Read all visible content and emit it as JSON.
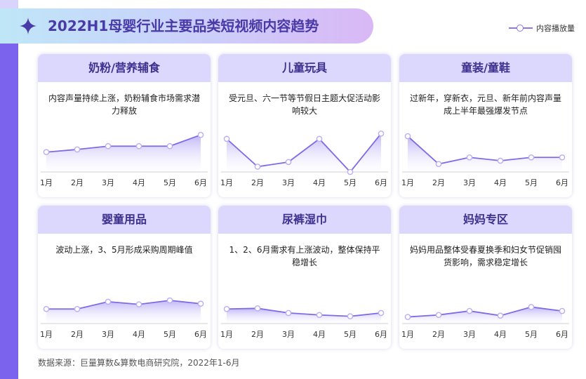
{
  "title": "2022H1母婴行业主要品类短视频内容趋势",
  "legend_label": "内容播放量",
  "footer": "数据来源：巨量算数&算数电商研究院，2022年1-6月",
  "colors": {
    "accent": "#7b63ee",
    "line": "#7d6ce6",
    "card_header": "#dcd7fd",
    "title": "#4a3aa8"
  },
  "cards": [
    {
      "title": "奶粉/营养辅食",
      "desc": "内容声量持续上涨，奶粉辅食市场需求潜力释放"
    },
    {
      "title": "儿童玩具",
      "desc": "受元旦、六一节等节假日主题大促活动影响较大"
    },
    {
      "title": "童装/童鞋",
      "desc": "过新年，穿新衣，元旦、新年前内容声量成上半年最强爆发节点"
    },
    {
      "title": "婴童用品",
      "desc": "波动上涨，3、5月形成采购周期峰值"
    },
    {
      "title": "尿裤湿巾",
      "desc": "1、2、6月需求有上涨波动，整体保持平稳增长"
    },
    {
      "title": "妈妈专区",
      "desc": "妈妈用品整体受春夏换季和妇女节促销囤货影响，需求稳定增长"
    }
  ],
  "chart_data": [
    {
      "type": "line",
      "title": "奶粉/营养辅食",
      "x": [
        "1月",
        "2月",
        "3月",
        "4月",
        "5月",
        "6月"
      ],
      "series": [
        {
          "name": "内容播放量",
          "values": [
            30,
            34,
            39,
            39,
            39,
            56
          ]
        }
      ],
      "ylim": [
        0,
        70
      ]
    },
    {
      "type": "line",
      "title": "儿童玩具",
      "x": [
        "1月",
        "2月",
        "3月",
        "4月",
        "5月",
        "6月"
      ],
      "series": [
        {
          "name": "内容播放量",
          "values": [
            50,
            8,
            15,
            50,
            0,
            58
          ]
        }
      ],
      "ylim": [
        0,
        70
      ]
    },
    {
      "type": "line",
      "title": "童装/童鞋",
      "x": [
        "1月",
        "2月",
        "3月",
        "4月",
        "5月",
        "6月"
      ],
      "series": [
        {
          "name": "内容播放量",
          "values": [
            54,
            12,
            22,
            17,
            22,
            22
          ]
        }
      ],
      "ylim": [
        0,
        70
      ]
    },
    {
      "type": "line",
      "title": "婴童用品",
      "x": [
        "1月",
        "2月",
        "3月",
        "4月",
        "5月",
        "6月"
      ],
      "series": [
        {
          "name": "内容播放量",
          "values": [
            22,
            22,
            33,
            29,
            35,
            30
          ]
        }
      ],
      "ylim": [
        0,
        70
      ]
    },
    {
      "type": "line",
      "title": "尿裤湿巾",
      "x": [
        "1月",
        "2月",
        "3月",
        "4月",
        "5月",
        "6月"
      ],
      "series": [
        {
          "name": "内容播放量",
          "values": [
            22,
            23,
            16,
            13,
            11,
            16
          ]
        }
      ],
      "ylim": [
        0,
        70
      ]
    },
    {
      "type": "line",
      "title": "妈妈专区",
      "x": [
        "1月",
        "2月",
        "3月",
        "4月",
        "5月",
        "6月"
      ],
      "series": [
        {
          "name": "内容播放量",
          "values": [
            10,
            13,
            19,
            12,
            25,
            19
          ]
        }
      ],
      "ylim": [
        0,
        70
      ]
    }
  ]
}
